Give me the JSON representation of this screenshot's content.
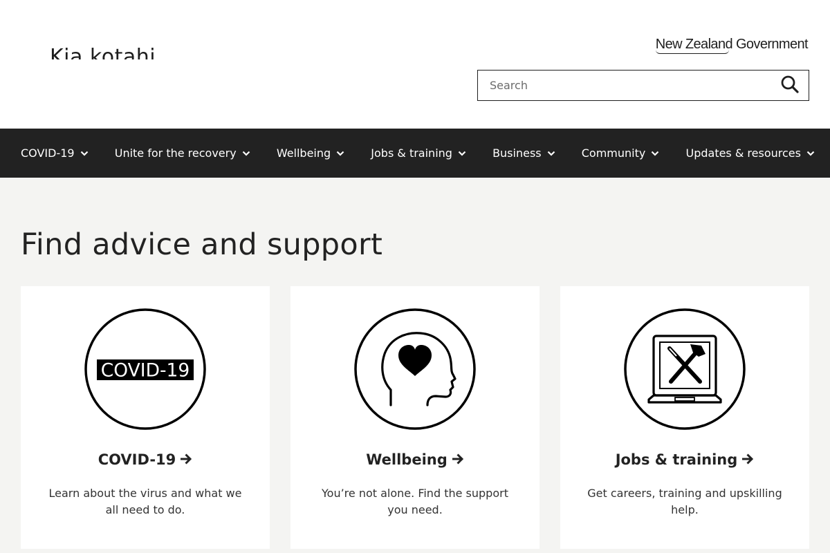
{
  "header": {
    "site_logo_text": "Kia kotahi",
    "govt_logo_text": "New Zealand Government",
    "search": {
      "placeholder": "Search",
      "value": "",
      "button_icon": "search-icon"
    }
  },
  "nav": {
    "items": [
      {
        "label": "COVID-19"
      },
      {
        "label": "Unite for the recovery"
      },
      {
        "label": "Wellbeing"
      },
      {
        "label": "Jobs & training"
      },
      {
        "label": "Business"
      },
      {
        "label": "Community"
      },
      {
        "label": "Updates & resources"
      }
    ],
    "icon": "chevron-down-icon"
  },
  "main": {
    "title": "Find advice and support",
    "cards": [
      {
        "icon": "covid-19-badge-icon",
        "icon_text": "COVID-19",
        "title": "COVID-19",
        "description": "Learn about the virus and what we all need to do."
      },
      {
        "icon": "head-heart-icon",
        "title": "Wellbeing",
        "description": "You’re not alone. Find the support you need."
      },
      {
        "icon": "laptop-tools-icon",
        "title": "Jobs & training",
        "description": "Get careers, training and upskilling help."
      }
    ]
  },
  "colors": {
    "nav_background": "#222222",
    "page_background": "#f4f4f2",
    "card_background": "#ffffff",
    "text": "#1e1e1e"
  }
}
